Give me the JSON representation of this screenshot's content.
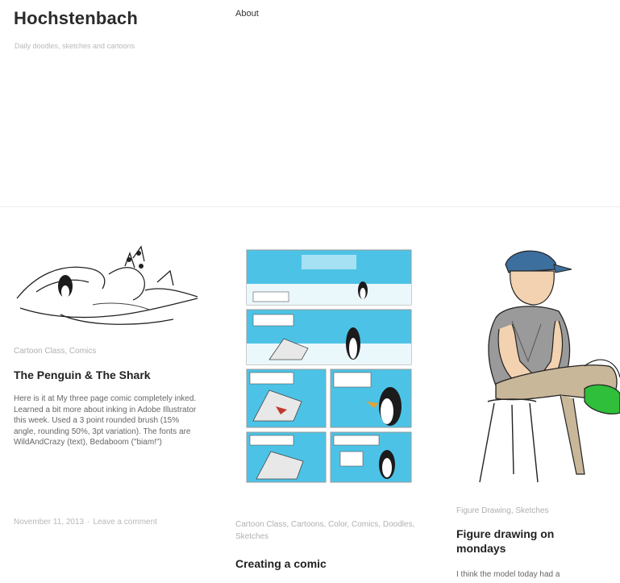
{
  "site": {
    "title": "Hochstenbach",
    "description": "Daily doodles, sketches and cartoons"
  },
  "nav": {
    "about": "About"
  },
  "posts": [
    {
      "categories": [
        "Cartoon Class",
        "Comics"
      ],
      "title": "The Penguin & The Shark",
      "excerpt": "Here is it at My three page comic completely inked. Learned a bit more about inking in Adobe Illustrator this week. Used a 3 point rounded brush (15% angle, rounding 50%, 3pt variation). The fonts are WildAndCrazy (text), Bedaboom (\"biam!\")",
      "date": "November 11, 2013",
      "separator": "·",
      "comment": "Leave a comment"
    },
    {
      "categories": [
        "Cartoon Class",
        "Cartoons",
        "Color",
        "Comics",
        "Doodles",
        "Sketches"
      ],
      "title": "Creating a comic"
    },
    {
      "categories": [
        "Figure Drawing",
        "Sketches"
      ],
      "title": "Figure drawing on mondays",
      "excerpt": "I think the model today had a"
    }
  ],
  "colors": {
    "comic_sky": "#4cc3e6",
    "shoe_green": "#2fbf3a",
    "cap_blue": "#3d6f9e"
  }
}
